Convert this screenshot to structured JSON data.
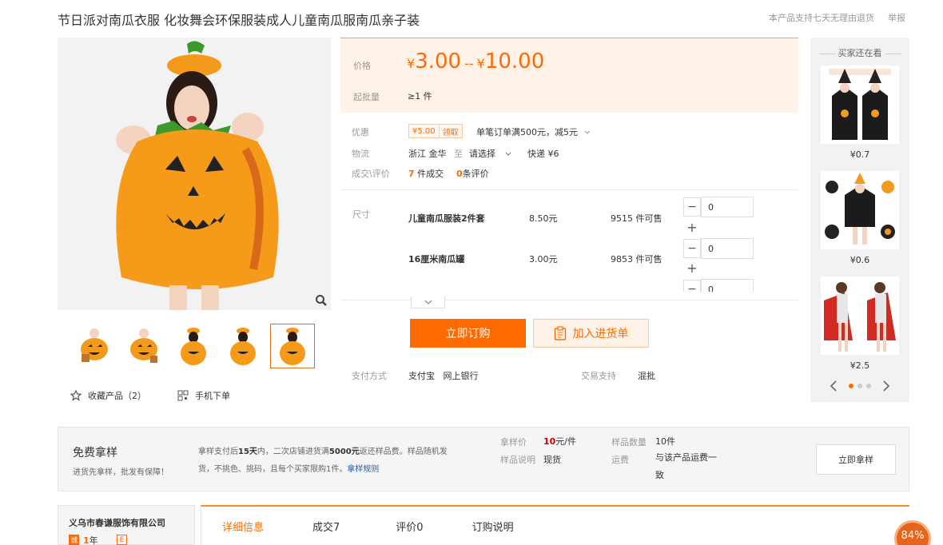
{
  "header": {
    "title": "节日派对南瓜衣服 化妆舞会环保服装成人儿童南瓜服南瓜亲子装",
    "support_text": "本产品支持七天无理由退货",
    "report_label": "举报"
  },
  "gallery": {
    "thumbnail_count": 5,
    "active_thumbnail": 5
  },
  "actions": {
    "favorite_label": "收藏产品（2）",
    "mobile_order_label": "手机下单"
  },
  "price": {
    "label": "价格",
    "currency": "¥",
    "min": "3.00",
    "separator": "--",
    "max": "10.00",
    "moq_label": "起批量",
    "moq_value": "≥1 件"
  },
  "promo": {
    "label": "优惠",
    "coupon_amount": "¥5.00",
    "coupon_action": "领取",
    "desc": "单笔订单满500元，减5元"
  },
  "logistics": {
    "label": "物流",
    "from": "浙江 金华",
    "to_word": "至",
    "to_select": "请选择",
    "express": "快递 ¥6"
  },
  "deals": {
    "label": "成交\\评价",
    "deal_count": "7",
    "deal_suffix": "件成交",
    "review_count": "0",
    "review_suffix": "条评价"
  },
  "sku": {
    "label": "尺寸",
    "rows": [
      {
        "name": "儿童南瓜服装2件套",
        "price": "8.50元",
        "stock": "9515 件可售",
        "qty": "0"
      },
      {
        "name": "16厘米南瓜罐",
        "price": "3.00元",
        "stock": "9853 件可售",
        "qty": "0"
      }
    ],
    "third_qty": "0"
  },
  "buttons": {
    "buy_now": "立即订购",
    "add_cart": "加入进货单"
  },
  "payment": {
    "label": "支付方式",
    "methods": "支付宝   网上银行",
    "trade_label": "交易支持",
    "trade_value": "混批"
  },
  "recommend": {
    "title": "买家还在看",
    "items": [
      {
        "price": "¥0.7"
      },
      {
        "price": "¥0.6"
      },
      {
        "price": "¥2.5"
      }
    ]
  },
  "sample": {
    "title": "免费拿样",
    "subtitle": "进货先拿样，批发有保障！",
    "desc_a": "拿样支付后",
    "desc_b": "15天",
    "desc_c": "内，二次店铺进货满",
    "desc_d": "5000元",
    "desc_e": "返还样品费。样品随机发货，不挑色、挑码，且每个买家限购1件。",
    "rule_link": "拿样规则",
    "sample_price_label": "拿样价",
    "sample_price_value": "10",
    "sample_price_unit": "元/件",
    "sample_note_label": "样品说明",
    "sample_note_value": "现货",
    "sample_qty_label": "样品数量",
    "sample_qty_value": "10件",
    "shipping_label": "运费",
    "shipping_value": "与该产品运费一致",
    "button": "立即拿样"
  },
  "shop": {
    "name": "义乌市春谦服饰有限公司",
    "badge": "诚",
    "years_num": "1",
    "years_suffix": "年",
    "icon2": "E"
  },
  "tabs": [
    {
      "label": "详细信息"
    },
    {
      "label": "成交7"
    },
    {
      "label": "评价0"
    },
    {
      "label": "订购说明"
    }
  ],
  "progress": {
    "percent": 84,
    "label": "84%"
  },
  "colors": {
    "accent": "#ff6a00",
    "pumpkin": "#f39a1c",
    "leaf": "#3c9a2c"
  }
}
